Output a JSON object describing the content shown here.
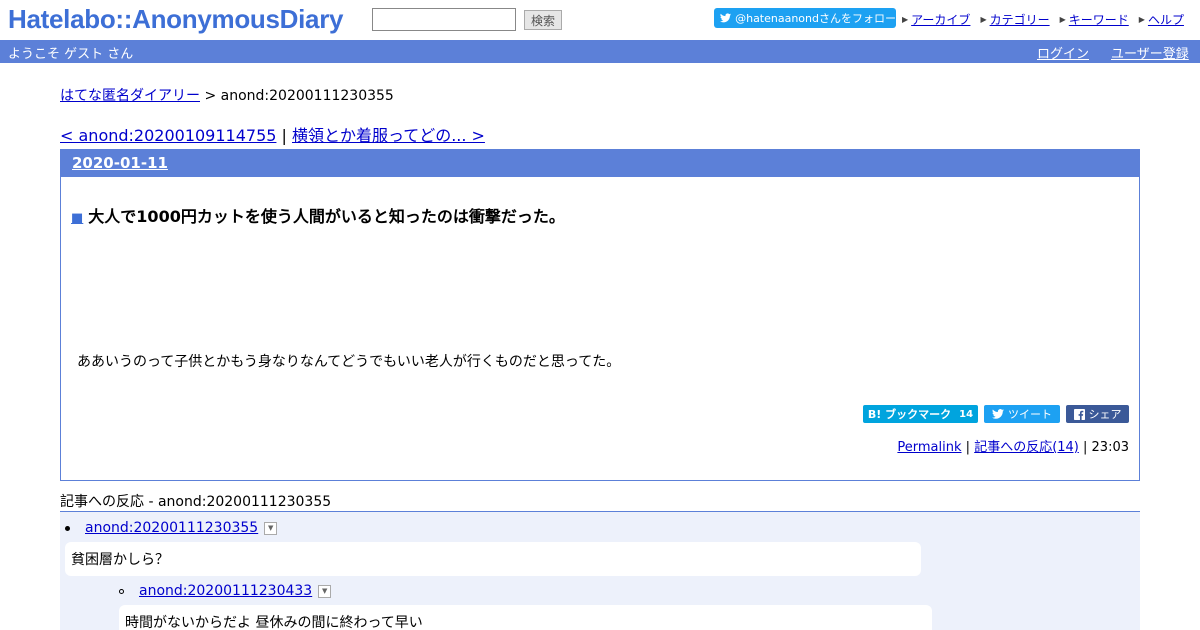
{
  "header": {
    "logo": "Hatelabo::AnonymousDiary",
    "search_value": "",
    "search_button": "検索",
    "follow_button": "@hatenaanondさんをフォロー",
    "links": [
      "アーカイブ",
      "カテゴリー",
      "キーワード",
      "ヘルプ"
    ]
  },
  "welcome": {
    "text": "ようこそ ゲスト さん",
    "login": "ログイン",
    "register": "ユーザー登録"
  },
  "breadcrumb": {
    "home": "はてな匿名ダイアリー",
    "separator": " > ",
    "current": "anond:20200111230355"
  },
  "article_nav": {
    "prev": "< anond:20200109114755",
    "separator": " | ",
    "next": "横領とか着服ってどの... >"
  },
  "day": {
    "date": "2020-01-11",
    "entry": {
      "mark": "■",
      "title": "大人で1000円カットを使う人間がいると知ったのは衝撃だった。",
      "body": "ああいうのって子供とかもう身なりなんてどうでもいい老人が行くものだと思ってた。",
      "share": {
        "bookmark_label": "B! ブックマーク",
        "bookmark_count": "14",
        "tweet_label": "ツイート",
        "share_label": "シェア"
      },
      "footer": {
        "permalink": "Permalink",
        "sep1": " | ",
        "reactions": "記事への反応(14)",
        "sep2": " | ",
        "time": "23:03"
      }
    }
  },
  "reactions": {
    "title": "記事への反応 - anond:20200111230355",
    "items": [
      {
        "id": "anond:20200111230355",
        "body": "貧困層かしら？"
      },
      {
        "id": "anond:20200111230433",
        "body": "時間がないからだよ 昼休みの間に終わって早い"
      }
    ]
  },
  "colors": {
    "accent": "#5c80d8",
    "logo": "#3d6fd6",
    "reactions_bg": "#edf1fb",
    "twitter": "#1da1f2",
    "hatena_bookmark": "#00a4de",
    "facebook": "#3b5998"
  }
}
